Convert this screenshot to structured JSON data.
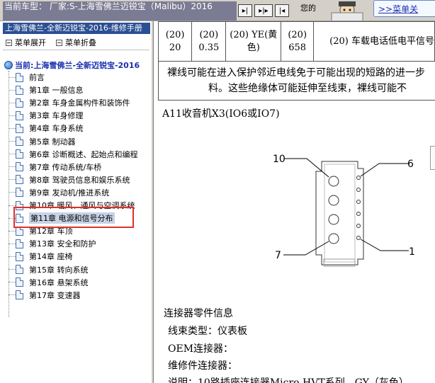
{
  "header": {
    "car_label": "当前车型：  厂家:S-上海雪佛兰迈锐宝（Malibu）2016",
    "nav_buttons": [
      "▸|",
      "▸|▸",
      "|◂"
    ],
    "hello_text": "您的",
    "menu_link": ">>菜单关"
  },
  "sidebar": {
    "manual_title": "上海雪佛兰-全新迈锐宝-2016-维修手册",
    "expand_label": "菜单展开",
    "collapse_label": "菜单折叠",
    "root_label": "当前:上海雪佛兰-全新迈锐宝-2016",
    "items": [
      {
        "label": "前言"
      },
      {
        "label": "第1章 一般信息"
      },
      {
        "label": "第2章 车身金属构件和装饰件"
      },
      {
        "label": "第3章 车身修理"
      },
      {
        "label": "第4章 车身系统"
      },
      {
        "label": "第5章 制动器"
      },
      {
        "label": "第6章 诊断概述、起始点和编程"
      },
      {
        "label": "第7章 传动系统/车桥"
      },
      {
        "label": "第8章 驾驶员信息和娱乐系统"
      },
      {
        "label": "第9章 发动机/推进系统"
      },
      {
        "label": "第10章 暖风、通风与空调系统"
      },
      {
        "label": "第11章 电源和信号分布"
      },
      {
        "label": "第12章 车顶"
      },
      {
        "label": "第13章 安全和防护"
      },
      {
        "label": "第14章 座椅"
      },
      {
        "label": "第15章 转向系统"
      },
      {
        "label": "第16章 悬架系统"
      },
      {
        "label": "第17章 变速器"
      }
    ],
    "selected_index": 11
  },
  "content": {
    "pin_row": [
      "(20)\n20",
      "(20)\n0.35",
      "(20) YE(黄\n色)",
      "(20)\n658",
      "(20) 车载电话低电平信号"
    ],
    "note_line1": "裸线可能在进入保护邻近电线免于可能出现的短路的进一步",
    "note_line2": "料。这些绝缘体可能延伸至线束，裸线可能不",
    "connector_title": "A11收音机X3(IO6或IO7)",
    "pin_labels": {
      "top_left": "10",
      "top_right": "6",
      "bottom_left": "7",
      "bottom_right": "1"
    },
    "info_heading": "连接器零件信息",
    "info_lines": [
      "线束类型：仪表板",
      "OEM连接器：",
      "维修件连接器：",
      "说明：10路插座连接器Micro HVT系列，GY（灰色）"
    ]
  }
}
